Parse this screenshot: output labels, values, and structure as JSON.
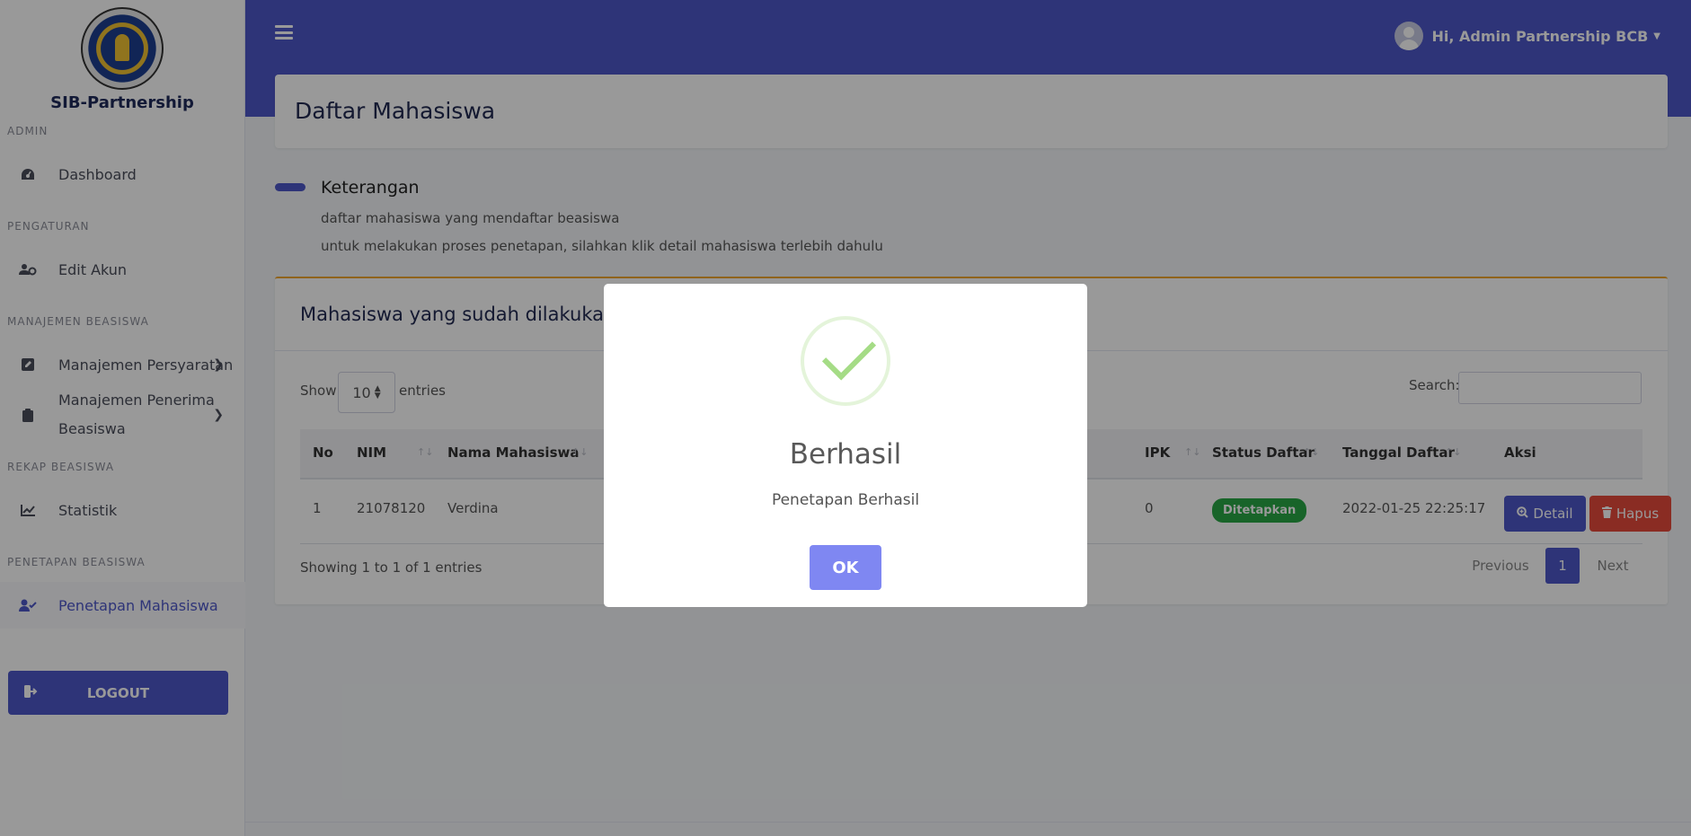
{
  "sidebar": {
    "brand_name": "SIB-Partnership",
    "sections": {
      "admin": "ADMIN",
      "pengaturan": "PENGATURAN",
      "manajemen": "MANAJEMEN BEASISWA",
      "rekap": "REKAP BEASISWA",
      "penetapan": "PENETAPAN BEASISWA"
    },
    "items": {
      "dashboard": "Dashboard",
      "edit_akun": "Edit Akun",
      "persyaratan": "Manajemen Persyaratan",
      "penerima_line1": "Manajemen Penerima",
      "penerima_line2": "Beasiswa",
      "statistik": "Statistik",
      "penetapan_mahasiswa": "Penetapan Mahasiswa"
    },
    "logout": "LOGOUT"
  },
  "topbar": {
    "user_greeting": "Hi, Admin Partnership BCB"
  },
  "header": {
    "title": "Daftar Mahasiswa"
  },
  "legend": {
    "title": "Keterangan",
    "line1": "daftar mahasiswa yang mendaftar beasiswa",
    "line2": "untuk melakukan proses penetapan, silahkan klik detail mahasiswa terlebih dahulu"
  },
  "table_card": {
    "title": "Mahasiswa yang sudah dilakuka",
    "show_label": "Show",
    "show_value": "10",
    "entries_label": "entries",
    "search_label": "Search:",
    "columns": {
      "no": "No",
      "nim": "NIM",
      "nama": "Nama Mahasiswa",
      "ipk": "IPK",
      "status": "Status Daftar",
      "tanggal": "Tanggal Daftar",
      "aksi": "Aksi"
    },
    "row": {
      "no": "1",
      "nim": "21078120",
      "nama": "Verdina",
      "ipk": "0",
      "status": "Ditetapkan",
      "tanggal": "2022-01-25 22:25:17",
      "detail": "Detail",
      "hapus": "Hapus"
    },
    "info": "Showing 1 to 1 of 1 entries",
    "pagination": {
      "previous": "Previous",
      "page": "1",
      "next": "Next"
    }
  },
  "modal": {
    "title": "Berhasil",
    "text": "Penetapan Berhasil",
    "ok": "OK"
  },
  "colors": {
    "primary": "#4e57c9",
    "success": "#28a745",
    "danger": "#e74a3b",
    "accent": "#f0a530",
    "check": "#a5dc86"
  }
}
